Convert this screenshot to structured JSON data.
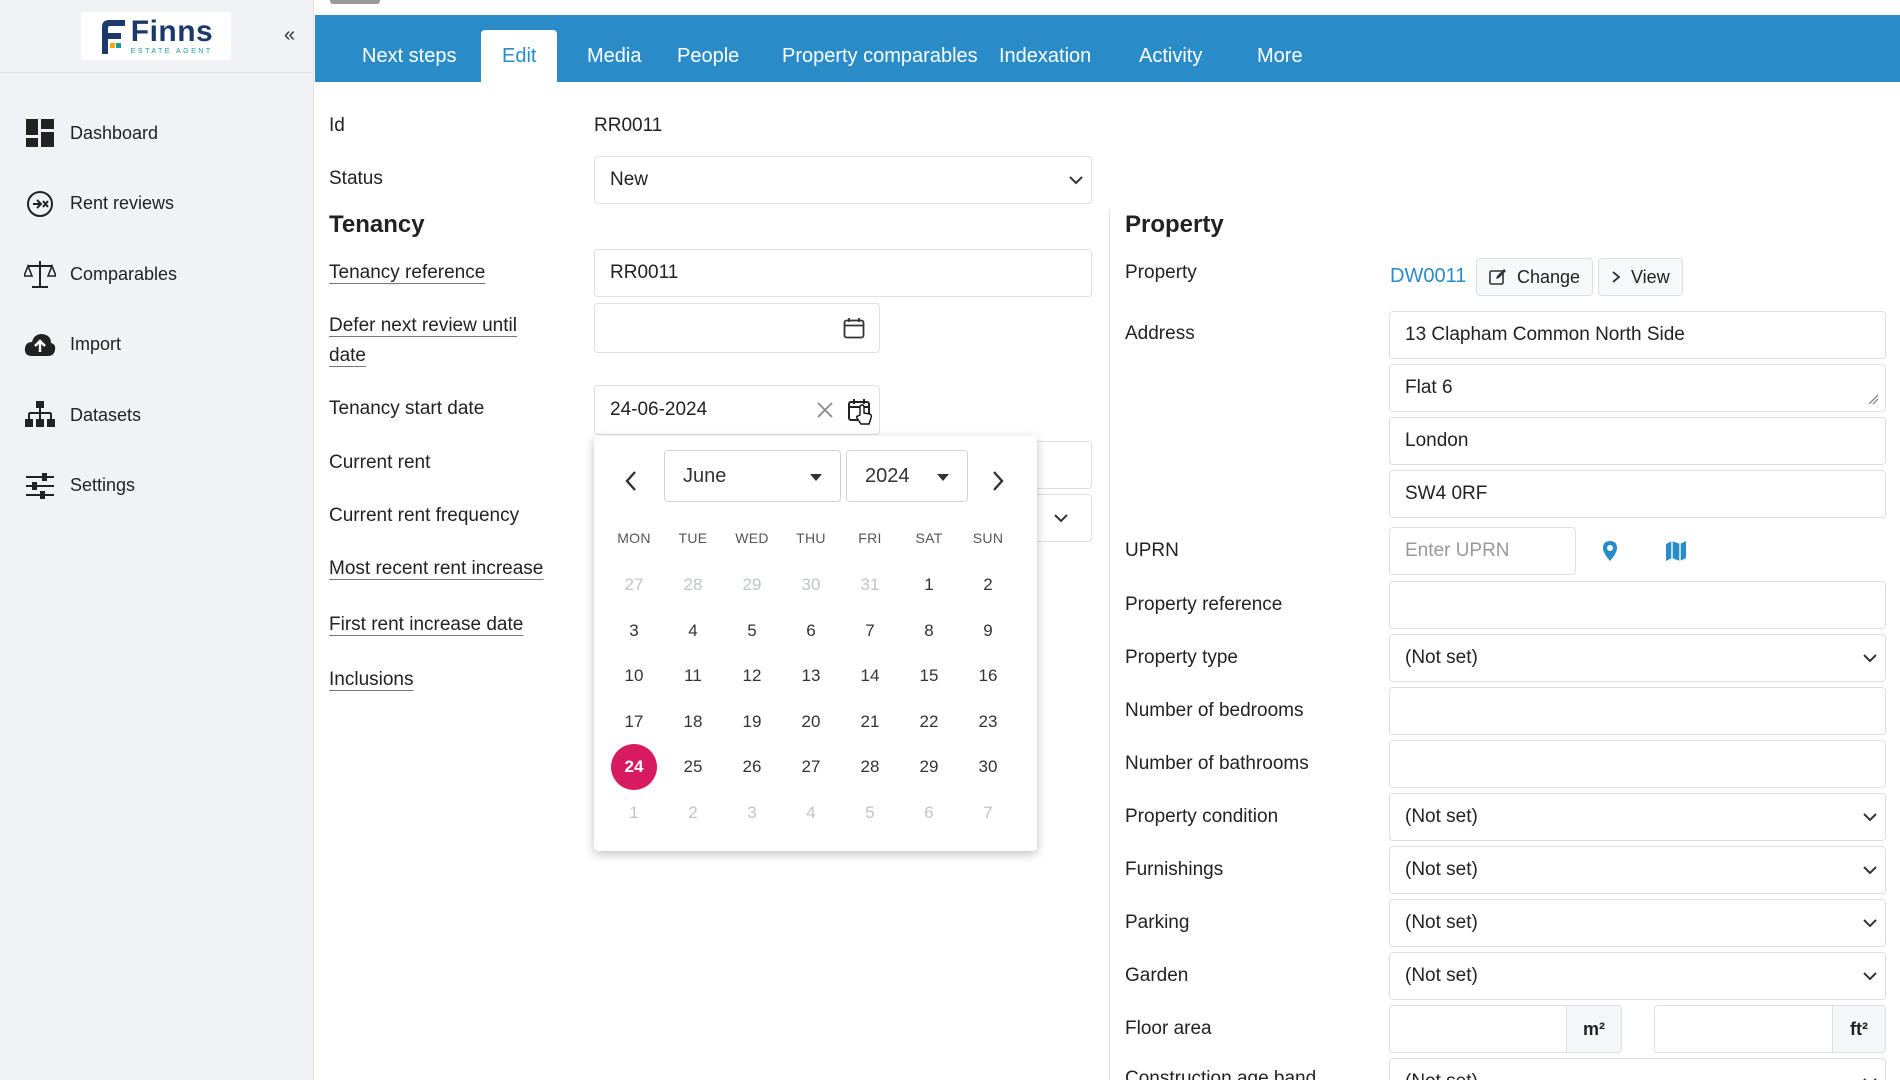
{
  "brand": {
    "name": "Finns",
    "subtitle": "ESTATE AGENT",
    "collapse": "«"
  },
  "sidebar": {
    "items": [
      {
        "label": "Dashboard",
        "icon": "dashboard-icon"
      },
      {
        "label": "Rent reviews",
        "icon": "rent-reviews-icon"
      },
      {
        "label": "Comparables",
        "icon": "scales-icon"
      },
      {
        "label": "Import",
        "icon": "cloud-upload-icon"
      },
      {
        "label": "Datasets",
        "icon": "hierarchy-icon"
      },
      {
        "label": "Settings",
        "icon": "sliders-icon"
      }
    ]
  },
  "tabs": [
    "Next steps",
    "Edit",
    "Media",
    "People",
    "Property comparables",
    "Indexation",
    "Activity",
    "More"
  ],
  "active_tab": "Edit",
  "form": {
    "id_label": "Id",
    "id_value": "RR0011",
    "status_label": "Status",
    "status_value": "New",
    "tenancy_heading": "Tenancy",
    "tenancy_reference_label": "Tenancy reference",
    "tenancy_reference_value": "RR0011",
    "defer_label_1": "Defer next review until",
    "defer_label_2": "date",
    "start_date_label": "Tenancy start date",
    "start_date_value": "24-06-2024",
    "current_rent_label": "Current rent",
    "rent_frequency_label": "Current rent frequency",
    "recent_increase_label": "Most recent rent increase",
    "first_increase_label": "First rent increase date",
    "inclusions_label": "Inclusions"
  },
  "datepicker": {
    "month": "June",
    "year": "2024",
    "weekdays": [
      "MON",
      "TUE",
      "WED",
      "THU",
      "FRI",
      "SAT",
      "SUN"
    ],
    "weeks": [
      [
        [
          "27",
          0
        ],
        [
          "28",
          0
        ],
        [
          "29",
          0
        ],
        [
          "30",
          0
        ],
        [
          "31",
          0
        ],
        [
          "1",
          1
        ],
        [
          "2",
          1
        ]
      ],
      [
        [
          "3",
          1
        ],
        [
          "4",
          1
        ],
        [
          "5",
          1
        ],
        [
          "6",
          1
        ],
        [
          "7",
          1
        ],
        [
          "8",
          1
        ],
        [
          "9",
          1
        ]
      ],
      [
        [
          "10",
          1
        ],
        [
          "11",
          1
        ],
        [
          "12",
          1
        ],
        [
          "13",
          1
        ],
        [
          "14",
          1
        ],
        [
          "15",
          1
        ],
        [
          "16",
          1
        ]
      ],
      [
        [
          "17",
          1
        ],
        [
          "18",
          1
        ],
        [
          "19",
          1
        ],
        [
          "20",
          1
        ],
        [
          "21",
          1
        ],
        [
          "22",
          1
        ],
        [
          "23",
          1
        ]
      ],
      [
        [
          "24",
          1
        ],
        [
          "25",
          1
        ],
        [
          "26",
          1
        ],
        [
          "27",
          1
        ],
        [
          "28",
          1
        ],
        [
          "29",
          1
        ],
        [
          "30",
          1
        ]
      ],
      [
        [
          "1",
          0
        ],
        [
          "2",
          0
        ],
        [
          "3",
          0
        ],
        [
          "4",
          0
        ],
        [
          "5",
          0
        ],
        [
          "6",
          0
        ],
        [
          "7",
          0
        ]
      ]
    ],
    "selected": "24"
  },
  "property": {
    "heading": "Property",
    "property_label": "Property",
    "property_ref": "DW0011",
    "change_label": "Change",
    "view_label": "View",
    "address_label": "Address",
    "address_1": "13 Clapham Common North Side",
    "address_2": "Flat 6",
    "address_3": "London",
    "address_4": "SW4 0RF",
    "uprn_label": "UPRN",
    "uprn_placeholder": "Enter UPRN",
    "reference_label": "Property reference",
    "type_label": "Property type",
    "type_value": "(Not set)",
    "bedrooms_label": "Number of bedrooms",
    "bathrooms_label": "Number of bathrooms",
    "condition_label": "Property condition",
    "condition_value": "(Not set)",
    "furnishings_label": "Furnishings",
    "furnishings_value": "(Not set)",
    "parking_label": "Parking",
    "parking_value": "(Not set)",
    "garden_label": "Garden",
    "garden_value": "(Not set)",
    "floor_area_label": "Floor area",
    "unit_m2": "m²",
    "unit_ft2": "ft²",
    "construction_label": "Construction age band",
    "construction_value": "(Not set)"
  },
  "colors": {
    "accent": "#2a8bc9",
    "selected_day": "#d81b60",
    "sidebar_bg": "#f0f2f5"
  }
}
